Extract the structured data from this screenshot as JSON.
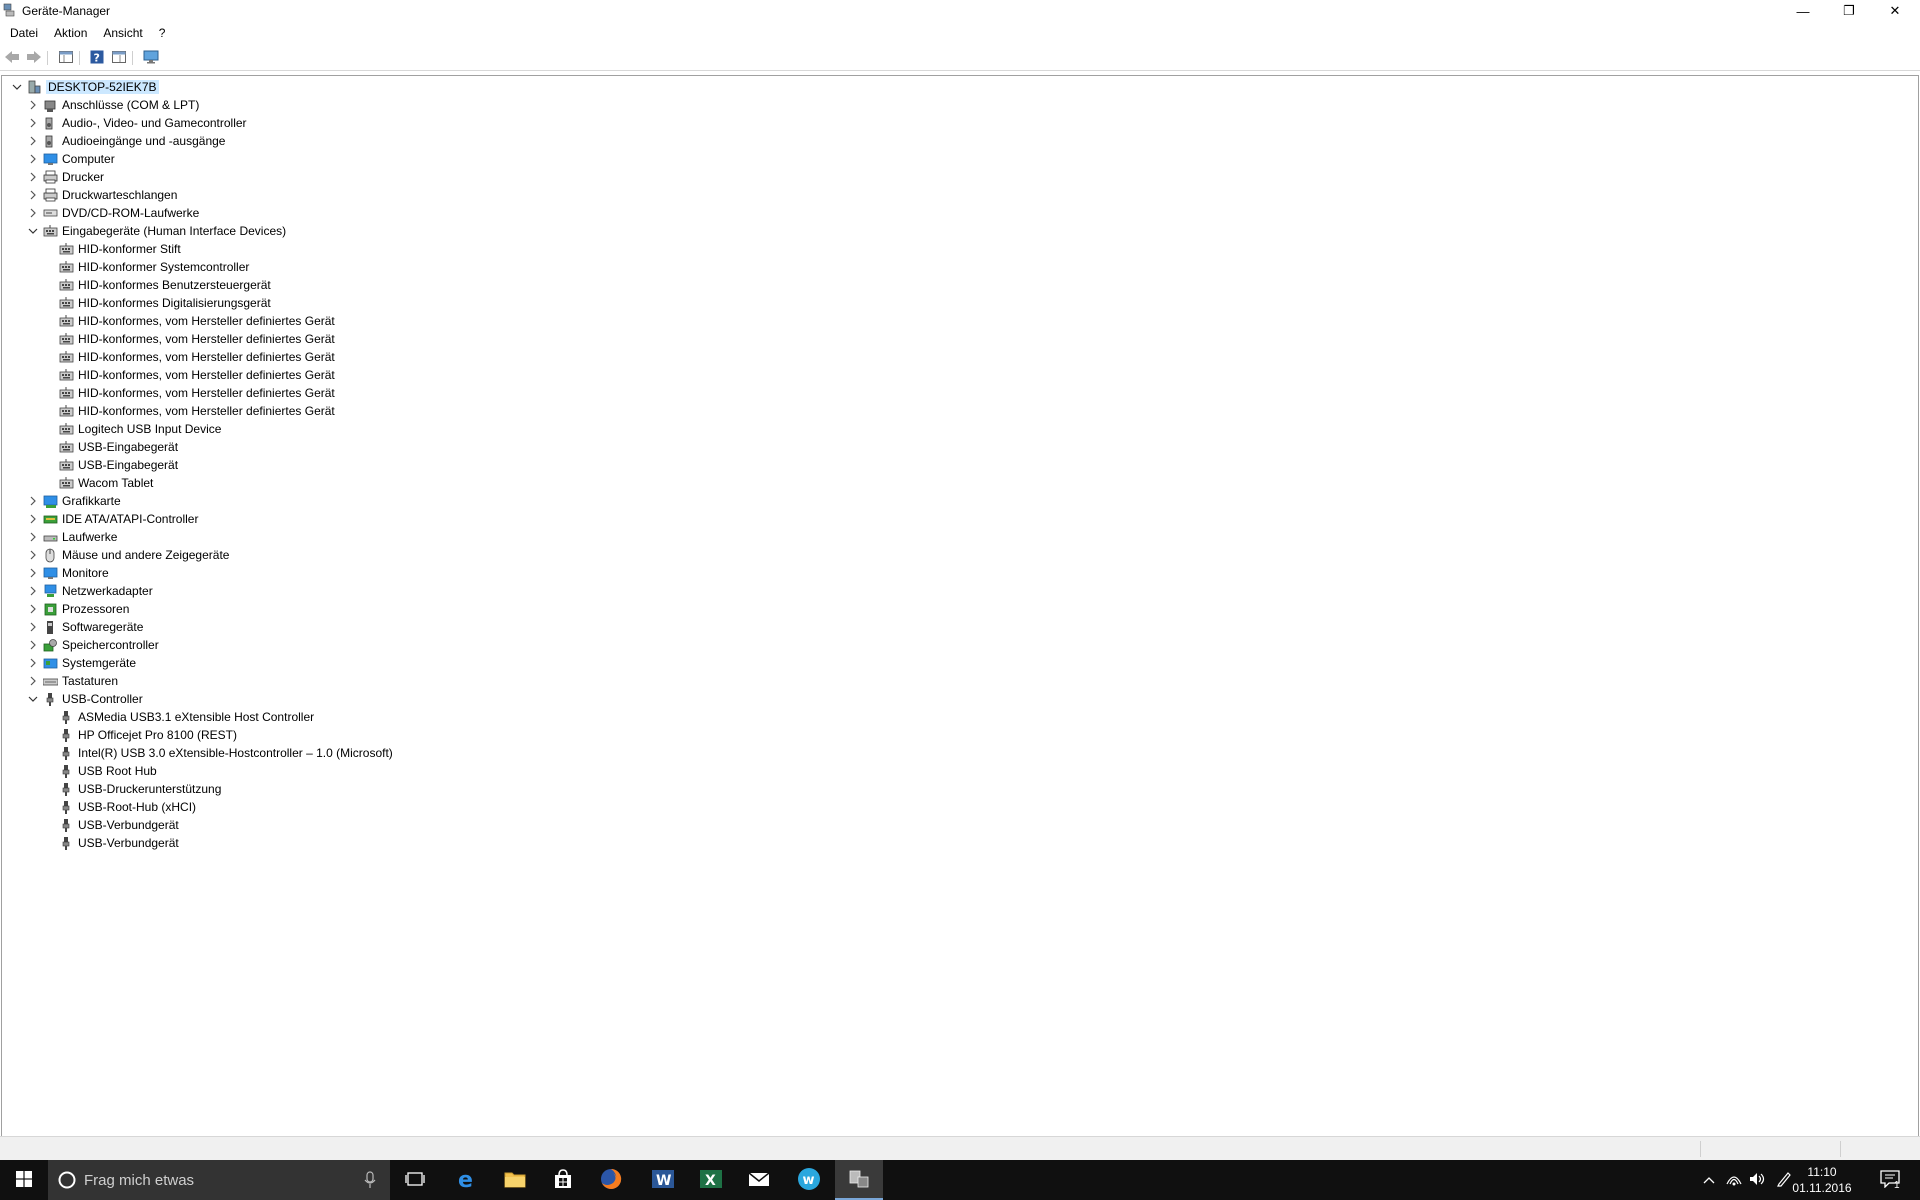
{
  "window": {
    "title": "Geräte-Manager",
    "buttons": {
      "minimize": "—",
      "restore": "❐",
      "close": "✕"
    }
  },
  "menu": [
    "Datei",
    "Aktion",
    "Ansicht",
    "?"
  ],
  "toolbar": [
    "back-arrow",
    "forward-arrow",
    "properties-pane",
    "help",
    "details-view",
    "monitor-scan"
  ],
  "tree": {
    "root": "DESKTOP-52IEK7B",
    "categories": [
      {
        "label": "Anschlüsse (COM & LPT)",
        "icon": "port",
        "expanded": false
      },
      {
        "label": "Audio-, Video- und Gamecontroller",
        "icon": "speaker",
        "expanded": false
      },
      {
        "label": "Audioeingänge und -ausgänge",
        "icon": "speaker",
        "expanded": false
      },
      {
        "label": "Computer",
        "icon": "monitor",
        "expanded": false
      },
      {
        "label": "Drucker",
        "icon": "printer",
        "expanded": false
      },
      {
        "label": "Druckwarteschlangen",
        "icon": "printer",
        "expanded": false
      },
      {
        "label": "DVD/CD-ROM-Laufwerke",
        "icon": "disc",
        "expanded": false
      },
      {
        "label": "Eingabegeräte (Human Interface Devices)",
        "icon": "hid",
        "expanded": true,
        "children": [
          "HID-konformer Stift",
          "HID-konformer Systemcontroller",
          "HID-konformes Benutzersteuergerät",
          "HID-konformes Digitalisierungsgerät",
          "HID-konformes, vom Hersteller definiertes Gerät",
          "HID-konformes, vom Hersteller definiertes Gerät",
          "HID-konformes, vom Hersteller definiertes Gerät",
          "HID-konformes, vom Hersteller definiertes Gerät",
          "HID-konformes, vom Hersteller definiertes Gerät",
          "HID-konformes, vom Hersteller definiertes Gerät",
          "Logitech USB Input Device",
          "USB-Eingabegerät",
          "USB-Eingabegerät",
          "Wacom Tablet"
        ]
      },
      {
        "label": "Grafikkarte",
        "icon": "display-adapter",
        "expanded": false
      },
      {
        "label": "IDE ATA/ATAPI-Controller",
        "icon": "ide",
        "expanded": false
      },
      {
        "label": "Laufwerke",
        "icon": "drive",
        "expanded": false
      },
      {
        "label": "Mäuse und andere Zeigegeräte",
        "icon": "mouse",
        "expanded": false
      },
      {
        "label": "Monitore",
        "icon": "monitor",
        "expanded": false
      },
      {
        "label": "Netzwerkadapter",
        "icon": "network",
        "expanded": false
      },
      {
        "label": "Prozessoren",
        "icon": "cpu",
        "expanded": false
      },
      {
        "label": "Softwaregeräte",
        "icon": "software",
        "expanded": false
      },
      {
        "label": "Speichercontroller",
        "icon": "storage",
        "expanded": false
      },
      {
        "label": "Systemgeräte",
        "icon": "system",
        "expanded": false
      },
      {
        "label": "Tastaturen",
        "icon": "keyboard",
        "expanded": false
      },
      {
        "label": "USB-Controller",
        "icon": "usb",
        "expanded": true,
        "children": [
          "ASMedia USB3.1 eXtensible Host Controller",
          "HP Officejet Pro 8100 (REST)",
          "Intel(R) USB 3.0 eXtensible-Hostcontroller – 1.0 (Microsoft)",
          "USB Root Hub",
          "USB-Druckerunterstützung",
          "USB-Root-Hub (xHCI)",
          "USB-Verbundgerät",
          "USB-Verbundgerät"
        ]
      }
    ]
  },
  "taskbar": {
    "search_placeholder": "Frag mich etwas",
    "apps": [
      "task-view",
      "edge",
      "file-explorer",
      "store",
      "firefox",
      "word",
      "excel",
      "mail",
      "app-w",
      "device-manager"
    ],
    "clock_time": "11:10",
    "clock_date": "01.11.2016",
    "notification_count": "1"
  },
  "colors": {
    "selection": "#cce8ff",
    "taskbar": "#101010",
    "search_box": "#333333",
    "accent": "#1e5fb4"
  }
}
